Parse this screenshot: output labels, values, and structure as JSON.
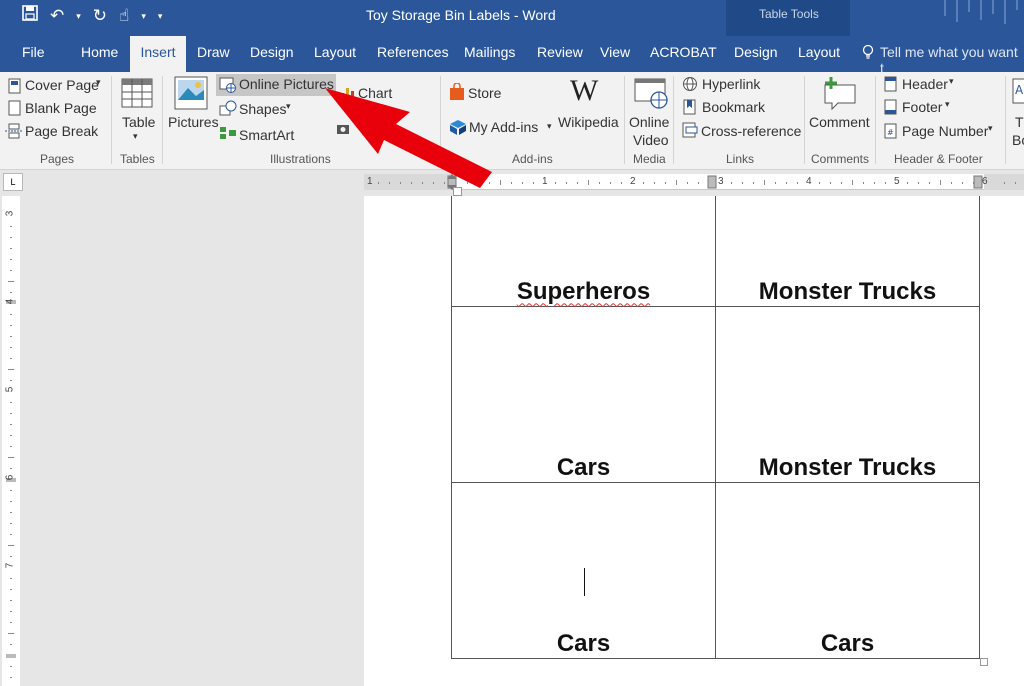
{
  "window": {
    "title": "Toy Storage Bin Labels - Word",
    "contextual_group": "Table Tools"
  },
  "quick_access": {
    "save_icon": "save-icon",
    "undo_icon": "undo-icon",
    "redo_icon": "redo-icon",
    "touch_icon": "touch-mode-icon",
    "undo": "↶",
    "redo": "↻",
    "touch": "☝",
    "dropdown": "▾",
    "customize": "▾"
  },
  "tabs": {
    "file": "File",
    "home": "Home",
    "insert": "Insert",
    "draw": "Draw",
    "design": "Design",
    "layout": "Layout",
    "references": "References",
    "mailings": "Mailings",
    "review": "Review",
    "view": "View",
    "acrobat": "ACROBAT",
    "table_design": "Design",
    "table_layout": "Layout",
    "tell_me": "Tell me what you want t"
  },
  "ribbon": {
    "pages": {
      "cover_page": "Cover Page",
      "blank_page": "Blank Page",
      "page_break": "Page Break",
      "label": "Pages"
    },
    "tables": {
      "table": "Table",
      "label": "Tables"
    },
    "illustrations": {
      "pictures": "Pictures",
      "online_pictures": "Online Pictures",
      "shapes": "Shapes",
      "smartart": "SmartArt",
      "chart": "Chart",
      "label": "Illustrations"
    },
    "addins": {
      "store": "Store",
      "my_addins": "My Add-ins",
      "wikipedia": "Wikipedia",
      "label": "Add-ins",
      "wiki_glyph": "W"
    },
    "media": {
      "online_video": "Online",
      "online_video2": "Video",
      "label": "Media"
    },
    "links": {
      "hyperlink": "Hyperlink",
      "bookmark": "Bookmark",
      "cross_reference": "Cross-reference",
      "label": "Links"
    },
    "comments": {
      "comment": "Comment",
      "label": "Comments"
    },
    "header_footer": {
      "header": "Header",
      "footer": "Footer",
      "page_number": "Page Number",
      "label": "Header & Footer"
    },
    "text_partial": {
      "t": "T",
      "bo": "Bo"
    },
    "dropdown_arrow": "▾"
  },
  "ruler": {
    "top_numbers": [
      "1",
      "1",
      "2",
      "3",
      "4",
      "5",
      "6"
    ],
    "left_numbers": [
      "3",
      "4",
      "5",
      "6",
      "7"
    ],
    "corner": "L"
  },
  "document": {
    "labels": [
      [
        "Superheros",
        "Monster Trucks"
      ],
      [
        "Cars",
        "Monster Trucks"
      ],
      [
        "Cars",
        "Cars"
      ]
    ]
  },
  "accent_colors": {
    "word_blue": "#2b579a",
    "arrow_red": "#e8000b"
  }
}
